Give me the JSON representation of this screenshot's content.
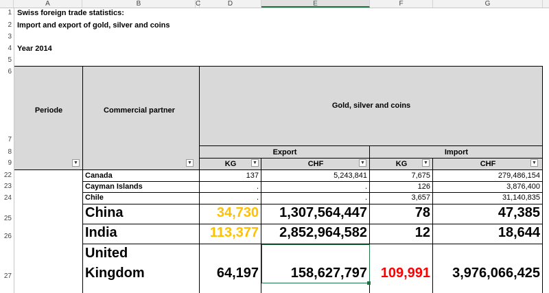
{
  "columns": [
    "A",
    "B",
    "C",
    "D",
    "E",
    "F",
    "G"
  ],
  "title_line1": "Swiss foreign trade statistics:",
  "title_line2": "Import and export of gold, silver and coins",
  "year": "Year 2014",
  "headers": {
    "periode": "Periode",
    "partner": "Commercial partner",
    "group": "Gold, silver and coins",
    "export": "Export",
    "import": "Import",
    "kg": "KG",
    "chf": "CHF"
  },
  "row_numbers": [
    "1",
    "2",
    "3",
    "4",
    "5",
    "6",
    "7",
    "8",
    "9",
    "22",
    "23",
    "24",
    "25",
    "26",
    "27"
  ],
  "rows": [
    {
      "partner": "Canada",
      "exp_kg": "137",
      "exp_chf": "5,243,841",
      "imp_kg": "7,675",
      "imp_chf": "279,486,154"
    },
    {
      "partner": "Cayman Islands",
      "exp_kg": ".",
      "exp_chf": ".",
      "imp_kg": "126",
      "imp_chf": "3,876,400"
    },
    {
      "partner": "Chile",
      "exp_kg": ".",
      "exp_chf": ".",
      "imp_kg": "3,657",
      "imp_chf": "31,140,835"
    },
    {
      "partner": "China",
      "exp_kg": "34,730",
      "exp_chf": "1,307,564,447",
      "imp_kg": "78",
      "imp_chf": "47,385"
    },
    {
      "partner": "India",
      "exp_kg": "113,377",
      "exp_chf": "2,852,964,582",
      "imp_kg": "12",
      "imp_chf": "18,644"
    },
    {
      "partner_l1": "United",
      "partner_l2": "Kingdom",
      "exp_kg": "64,197",
      "exp_chf": "158,627,797",
      "imp_kg": "109,991",
      "imp_chf": "3,976,066,425"
    }
  ],
  "colors": {
    "highlight_orange": "#ffc000",
    "highlight_red": "#ff0000",
    "selection": "#217346"
  },
  "icons": {
    "filter": "filter-dropdown-icon"
  }
}
